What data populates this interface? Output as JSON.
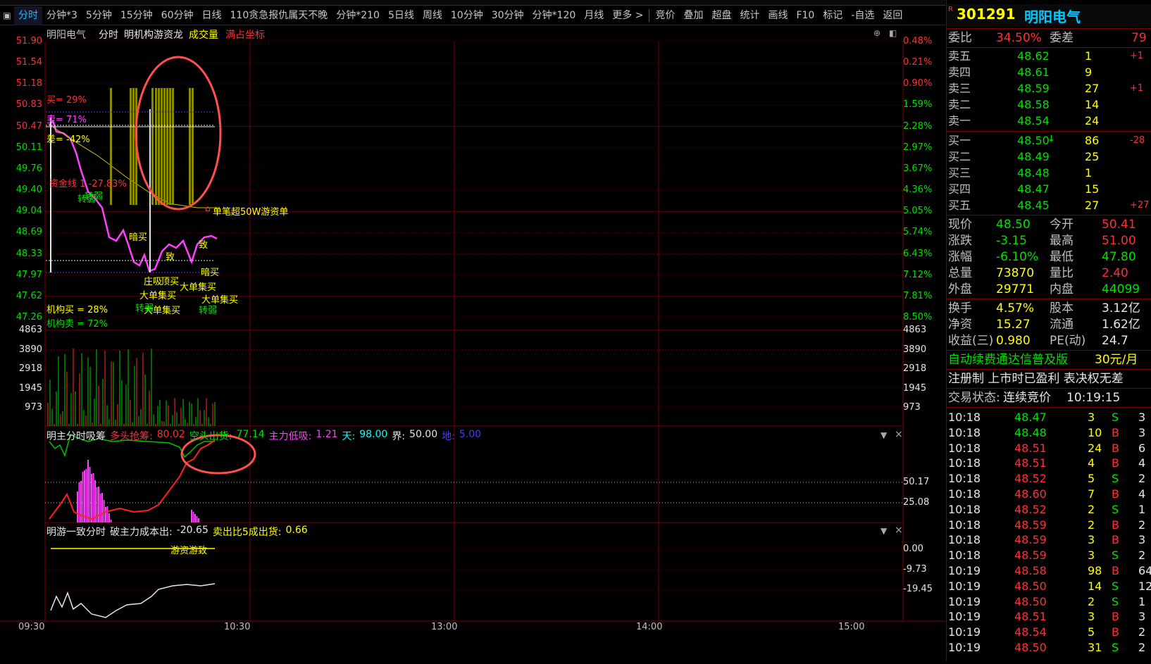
{
  "tabs": {
    "items": [
      "分时",
      "分钟*3",
      "5分钟",
      "15分钟",
      "60分钟",
      "日线",
      "110贪急报仇属天不晚",
      "分钟*210",
      "5日线",
      "周线",
      "10分钟",
      "30分钟",
      "分钟*120",
      "月线",
      "更多 >",
      "竞价",
      "叠加",
      "超盘",
      "统计",
      "画线",
      "F10",
      "标记",
      "-自选",
      "返回"
    ]
  },
  "main": {
    "title": "明阳电气",
    "mode": "分时",
    "indicator": "明机构游资龙",
    "volume_label": "成交量",
    "coord_label": "满占坐标",
    "price_ticks": [
      "51.90",
      "51.54",
      "51.18",
      "50.83",
      "50.47",
      "50.11",
      "49.76",
      "49.40",
      "49.04",
      "48.69",
      "48.33",
      "47.97",
      "47.62",
      "47.26"
    ],
    "pct_ticks": [
      "0.48%",
      "0.21%",
      "0.90%",
      "1.59%",
      "2.28%",
      "2.97%",
      "3.67%",
      "4.36%",
      "5.05%",
      "5.74%",
      "6.43%",
      "7.12%",
      "7.81%",
      "8.50%"
    ],
    "vol_ticks": [
      "4863",
      "3890",
      "2918",
      "1945",
      "973"
    ],
    "buy_pct": "买= 29%",
    "sell_pct": "卖= 71%",
    "diff_pct": "差= -42%",
    "inst_buy": "机构买 = 28%",
    "inst_sell": "机构卖 = 72%",
    "fund_label": "资金线 1 -27.83%",
    "big_order": "单笔超50W游资单",
    "labels": {
      "anmai1": "暗买",
      "anmai2": "暗买",
      "zhuang": "庄吸",
      "dingmai": "顶买",
      "big1": "大单集买",
      "big2": "大单集买",
      "big3": "大单集买",
      "big4": "大单集买",
      "weak1": "转弱",
      "weak2": "转弱",
      "weak3": "转弱",
      "weak4": "转弱",
      "zhi1": "致",
      "zhi2": "致"
    }
  },
  "panel2": {
    "title": "明主分时吸筹",
    "a_label": "多头抢筹:",
    "a_val": "80.02",
    "b_label": "空头出货:",
    "b_val": "77.14",
    "c_label": "主力低吸:",
    "c_val": "1.21",
    "d_label": "天:",
    "d_val": "98.00",
    "e_label": "界:",
    "e_val": "50.00",
    "f_label": "地:",
    "f_val": "5.00",
    "ticks": [
      "50.17",
      "25.08"
    ]
  },
  "panel3": {
    "title": "明游一致分时",
    "a_label": "破主力成本出:",
    "a_val": "-20.65",
    "b_label": "卖出比5成出货:",
    "b_val": "0.66",
    "mark": "游资游致",
    "ticks": [
      "0.00",
      "-9.73",
      "-19.45"
    ]
  },
  "time_axis": [
    "09:30",
    "10:30",
    "13:00",
    "14:00",
    "15:00"
  ],
  "right": {
    "code": "301291",
    "name": "明阳电气",
    "weibi_label": "委比",
    "weibi_val": "34.50%",
    "weicha_label": "委差",
    "weicha_val": "79",
    "asks": [
      {
        "l": "卖五",
        "p": "48.62",
        "v": "1",
        "c": "+1"
      },
      {
        "l": "卖四",
        "p": "48.61",
        "v": "9",
        "c": ""
      },
      {
        "l": "卖三",
        "p": "48.59",
        "v": "27",
        "c": "+1"
      },
      {
        "l": "卖二",
        "p": "48.58",
        "v": "14",
        "c": ""
      },
      {
        "l": "卖一",
        "p": "48.54",
        "v": "24",
        "c": ""
      }
    ],
    "bids": [
      {
        "l": "买一",
        "p": "48.50",
        "v": "86",
        "c": "-28"
      },
      {
        "l": "买二",
        "p": "48.49",
        "v": "25",
        "c": ""
      },
      {
        "l": "买三",
        "p": "48.48",
        "v": "1",
        "c": ""
      },
      {
        "l": "买四",
        "p": "48.47",
        "v": "15",
        "c": ""
      },
      {
        "l": "买五",
        "p": "48.45",
        "v": "27",
        "c": "+27"
      }
    ],
    "stats": [
      {
        "a": "现价",
        "b": "48.50",
        "c": "今开",
        "d": "50.41"
      },
      {
        "a": "涨跌",
        "b": "-3.15",
        "c": "最高",
        "d": "51.00"
      },
      {
        "a": "涨幅",
        "b": "-6.10%",
        "c": "最低",
        "d": "47.80"
      },
      {
        "a": "总量",
        "b": "73870",
        "c": "量比",
        "d": "2.40"
      },
      {
        "a": "外盘",
        "b": "29771",
        "c": "内盘",
        "d": "44099"
      }
    ],
    "stats2": [
      {
        "a": "换手",
        "b": "4.57%",
        "c": "股本",
        "d": "3.12亿"
      },
      {
        "a": "净资",
        "b": "15.27",
        "c": "流通",
        "d": "1.62亿"
      },
      {
        "a": "收益(三)",
        "b": "0.980",
        "c": "PE(动)",
        "d": "24.7"
      }
    ],
    "ad": "自动续费通达信普及版",
    "ad_price": "30元/月",
    "notice": "注册制 上市时已盈利 表决权无差",
    "status_label": "交易状态:",
    "status_val": "连续竞价",
    "status_time": "10:19:15",
    "ticks": [
      {
        "t": "10:18",
        "p": "48.47",
        "v": "3",
        "d": "S",
        "n": "3"
      },
      {
        "t": "10:18",
        "p": "48.48",
        "v": "10",
        "d": "B",
        "n": "3"
      },
      {
        "t": "10:18",
        "p": "48.51",
        "v": "24",
        "d": "B",
        "n": "6"
      },
      {
        "t": "10:18",
        "p": "48.51",
        "v": "4",
        "d": "B",
        "n": "4"
      },
      {
        "t": "10:18",
        "p": "48.52",
        "v": "5",
        "d": "S",
        "n": "2"
      },
      {
        "t": "10:18",
        "p": "48.60",
        "v": "7",
        "d": "B",
        "n": "4"
      },
      {
        "t": "10:18",
        "p": "48.52",
        "v": "2",
        "d": "S",
        "n": "1"
      },
      {
        "t": "10:18",
        "p": "48.59",
        "v": "2",
        "d": "B",
        "n": "2"
      },
      {
        "t": "10:18",
        "p": "48.59",
        "v": "3",
        "d": "B",
        "n": "3"
      },
      {
        "t": "10:18",
        "p": "48.59",
        "v": "3",
        "d": "S",
        "n": "2"
      },
      {
        "t": "10:19",
        "p": "48.58",
        "v": "98",
        "d": "B",
        "n": "64"
      },
      {
        "t": "10:19",
        "p": "48.50",
        "v": "14",
        "d": "S",
        "n": "12"
      },
      {
        "t": "10:19",
        "p": "48.50",
        "v": "2",
        "d": "S",
        "n": "1"
      },
      {
        "t": "10:19",
        "p": "48.51",
        "v": "3",
        "d": "B",
        "n": "3"
      },
      {
        "t": "10:19",
        "p": "48.54",
        "v": "5",
        "d": "B",
        "n": "2"
      },
      {
        "t": "10:19",
        "p": "48.50",
        "v": "31",
        "d": "S",
        "n": "2"
      }
    ]
  },
  "colors": {
    "up": "#ff3030",
    "down": "#00e000",
    "grid": "#7a0000",
    "price_line": "#ff40ff",
    "avg_line": "#c8c800",
    "circle": "#ff5050"
  }
}
